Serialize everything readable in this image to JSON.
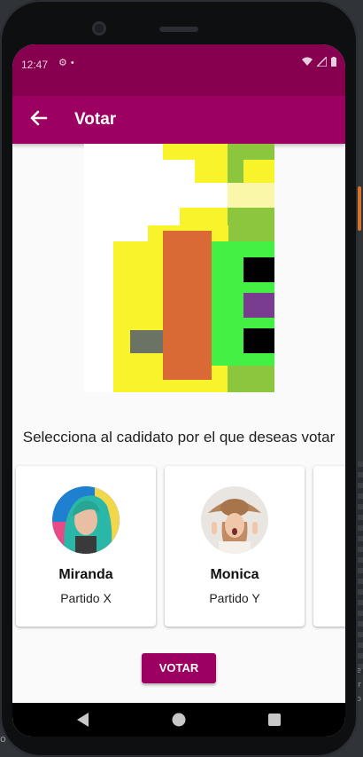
{
  "status_bar": {
    "time": "12:47"
  },
  "app_bar": {
    "title": "Votar",
    "back_icon": "arrow-back-icon"
  },
  "prompt": "Selecciona al cadidato por el que deseas votar",
  "candidates": [
    {
      "name": "Miranda",
      "party": "Partido X",
      "avatar_icon": "candidate-photo-miranda"
    },
    {
      "name": "Monica",
      "party": "Partido Y",
      "avatar_icon": "candidate-photo-monica"
    }
  ],
  "vote_button": {
    "label": "VOTAR"
  },
  "colors": {
    "primary": "#9c0060",
    "status_bar": "#870050",
    "background": "#fafafa"
  },
  "nav_icons": [
    "back-triangle-icon",
    "home-circle-icon",
    "recents-square-icon"
  ]
}
